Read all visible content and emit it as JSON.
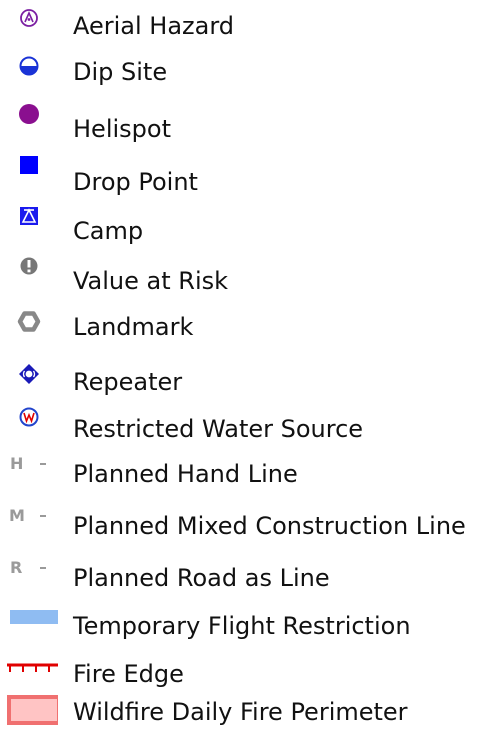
{
  "legend": {
    "items": [
      {
        "label": "Aerial Hazard",
        "icon": "aerial-hazard-icon",
        "color": "#7b1fa2"
      },
      {
        "label": "Dip Site",
        "icon": "dip-site-icon",
        "color": "#1a33d6"
      },
      {
        "label": "Helispot",
        "icon": "helispot-icon",
        "color": "#8a0f8f"
      },
      {
        "label": "Drop Point",
        "icon": "drop-point-icon",
        "color": "#0000ff"
      },
      {
        "label": "Camp",
        "icon": "camp-icon",
        "color": "#1a1aee"
      },
      {
        "label": "Value at Risk",
        "icon": "value-at-risk-icon",
        "color": "#777777"
      },
      {
        "label": "Landmark",
        "icon": "landmark-icon",
        "color": "#888888"
      },
      {
        "label": "Repeater",
        "icon": "repeater-icon",
        "color": "#1a1ab8"
      },
      {
        "label": "Restricted Water Source",
        "icon": "restricted-water-source-icon",
        "color": "#2244cc"
      },
      {
        "label": "Planned Hand Line",
        "icon": "planned-hand-line-icon",
        "prefix": "H",
        "color": "#9a9a9a"
      },
      {
        "label": "Planned Mixed Construction Line",
        "icon": "planned-mixed-construction-line-icon",
        "prefix": "M",
        "color": "#9a9a9a"
      },
      {
        "label": "Planned Road as Line",
        "icon": "planned-road-as-line-icon",
        "prefix": "R",
        "color": "#9a9a9a"
      },
      {
        "label": "Temporary Flight Restriction",
        "icon": "temporary-flight-restriction-icon",
        "color": "#8fbcf2"
      },
      {
        "label": "Fire Edge",
        "icon": "fire-edge-icon",
        "color": "#e00000"
      },
      {
        "label": "Wildfire Daily Fire Perimeter",
        "icon": "wildfire-daily-fire-perimeter-icon",
        "color": "#f08080"
      }
    ]
  }
}
